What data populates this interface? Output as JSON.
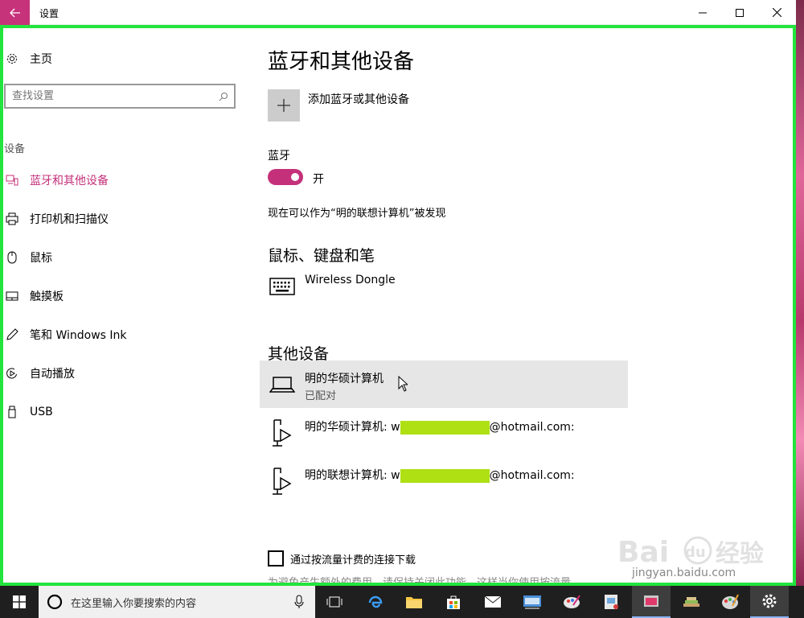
{
  "window": {
    "title": "设置"
  },
  "nav": {
    "home": "主页",
    "search_placeholder": "查找设置",
    "section": "设备",
    "items": [
      {
        "label": "蓝牙和其他设备",
        "icon": "bluetooth-devices-icon",
        "active": true
      },
      {
        "label": "打印机和扫描仪",
        "icon": "printer-icon",
        "active": false
      },
      {
        "label": "鼠标",
        "icon": "mouse-icon",
        "active": false
      },
      {
        "label": "触摸板",
        "icon": "touchpad-icon",
        "active": false
      },
      {
        "label": "笔和 Windows Ink",
        "icon": "pen-icon",
        "active": false
      },
      {
        "label": "自动播放",
        "icon": "autoplay-icon",
        "active": false
      },
      {
        "label": "USB",
        "icon": "usb-icon",
        "active": false
      }
    ]
  },
  "main": {
    "title": "蓝牙和其他设备",
    "add_device": "添加蓝牙或其他设备",
    "bluetooth_label": "蓝牙",
    "bluetooth_state": "开",
    "discoverable": "现在可以作为“明的联想计算机”被发现",
    "section_input": "鼠标、键盘和笔",
    "input_devices": [
      {
        "name": "Wireless Dongle",
        "icon": "keyboard-icon"
      }
    ],
    "section_other": "其他设备",
    "other_devices": [
      {
        "name": "明的华硕计算机",
        "status": "已配对",
        "icon": "laptop-icon"
      },
      {
        "name_prefix": "明的华硕计算机: w",
        "name_suffix": "@hotmail.com:",
        "icon": "media-device-icon"
      },
      {
        "name_prefix": "明的联想计算机: w",
        "name_suffix": "@hotmail.com:",
        "icon": "media-device-icon"
      }
    ],
    "metered_label": "通过按流量计费的连接下载",
    "metered_desc": "为避免产生额外的费用，请保持关闭此功能，这样当你使用按流量"
  },
  "watermark": {
    "brand": "Bai",
    "brand2": "du",
    "site": "经验",
    "url": "jingyan.baidu.com"
  },
  "taskbar": {
    "search_placeholder": "在这里输入你要搜索的内容"
  },
  "colors": {
    "accent": "#c4317a",
    "highlight": "#aee014",
    "frame": "#22e43c"
  }
}
